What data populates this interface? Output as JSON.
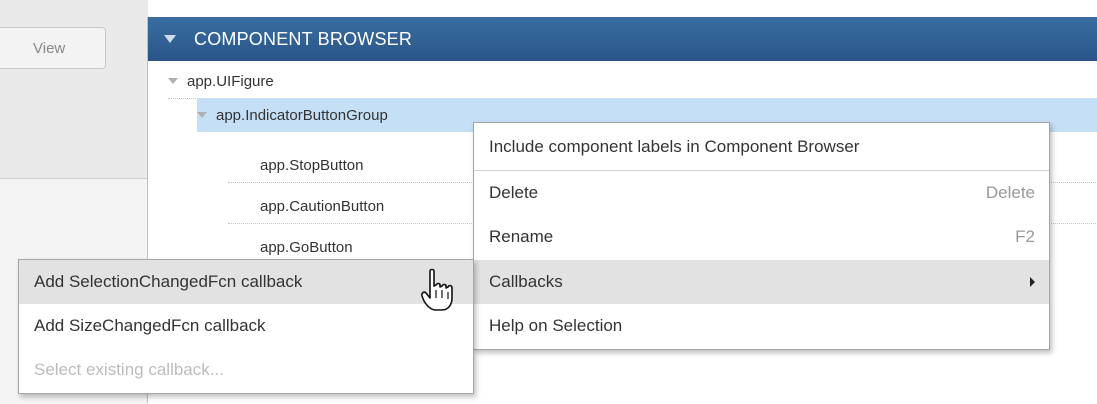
{
  "toolbar": {
    "view_label": "View"
  },
  "browser": {
    "title": "COMPONENT BROWSER",
    "tree": {
      "root": "app.UIFigure",
      "group": "app.IndicatorButtonGroup",
      "children": [
        "app.StopButton",
        "app.CautionButton",
        "app.GoButton"
      ]
    }
  },
  "context_menu": {
    "items": [
      {
        "label": "Include component labels in Component Browser",
        "shortcut": ""
      },
      {
        "label": "Delete",
        "shortcut": "Delete"
      },
      {
        "label": "Rename",
        "shortcut": "F2"
      },
      {
        "label": "Callbacks",
        "shortcut": ""
      },
      {
        "label": "Help on Selection",
        "shortcut": ""
      }
    ]
  },
  "callbacks_submenu": {
    "items": [
      {
        "label": "Add SelectionChangedFcn callback",
        "enabled": true
      },
      {
        "label": "Add SizeChangedFcn callback",
        "enabled": true
      },
      {
        "label": "Select existing callback...",
        "enabled": false
      }
    ]
  },
  "colors": {
    "header_blue": "#295588",
    "selection_blue": "#c4dff6",
    "menu_highlight": "#e2e2e2"
  }
}
